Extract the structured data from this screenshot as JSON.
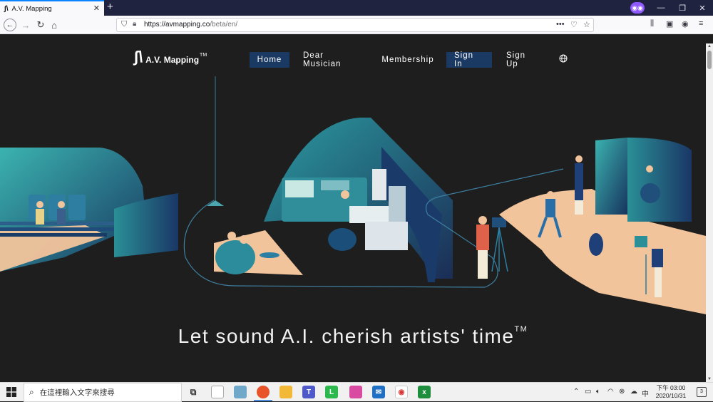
{
  "browser": {
    "tab_title": "A.V. Mapping",
    "new_tab": "+",
    "url_host": "https://avmapping.co",
    "url_path": "/beta/en/",
    "url_actions": "•••"
  },
  "site": {
    "logo_mark": "∫\\",
    "logo_name": "A.V. Mapping",
    "logo_tm": "TM",
    "nav": [
      {
        "label": "Home",
        "active": true
      },
      {
        "label": "Dear Musician",
        "active": false
      },
      {
        "label": "Membership",
        "active": false
      },
      {
        "label": "Sign In",
        "active": true
      },
      {
        "label": "Sign Up",
        "active": false
      }
    ],
    "tagline": "Let sound A.I. cherish artists' time",
    "tagline_tm": "TM"
  },
  "taskbar": {
    "search_placeholder": "在這裡輸入文字來搜尋",
    "time_line1": "下午 03:00",
    "time_line2": "2020/10/31",
    "notif_count": "3",
    "tray_lang": "中"
  },
  "colors": {
    "page_bg": "#1e1e1e",
    "teal": "#2a8f96",
    "navy": "#1b2d55",
    "peach": "#f2c49b",
    "nav_active": "#1b3a63"
  }
}
